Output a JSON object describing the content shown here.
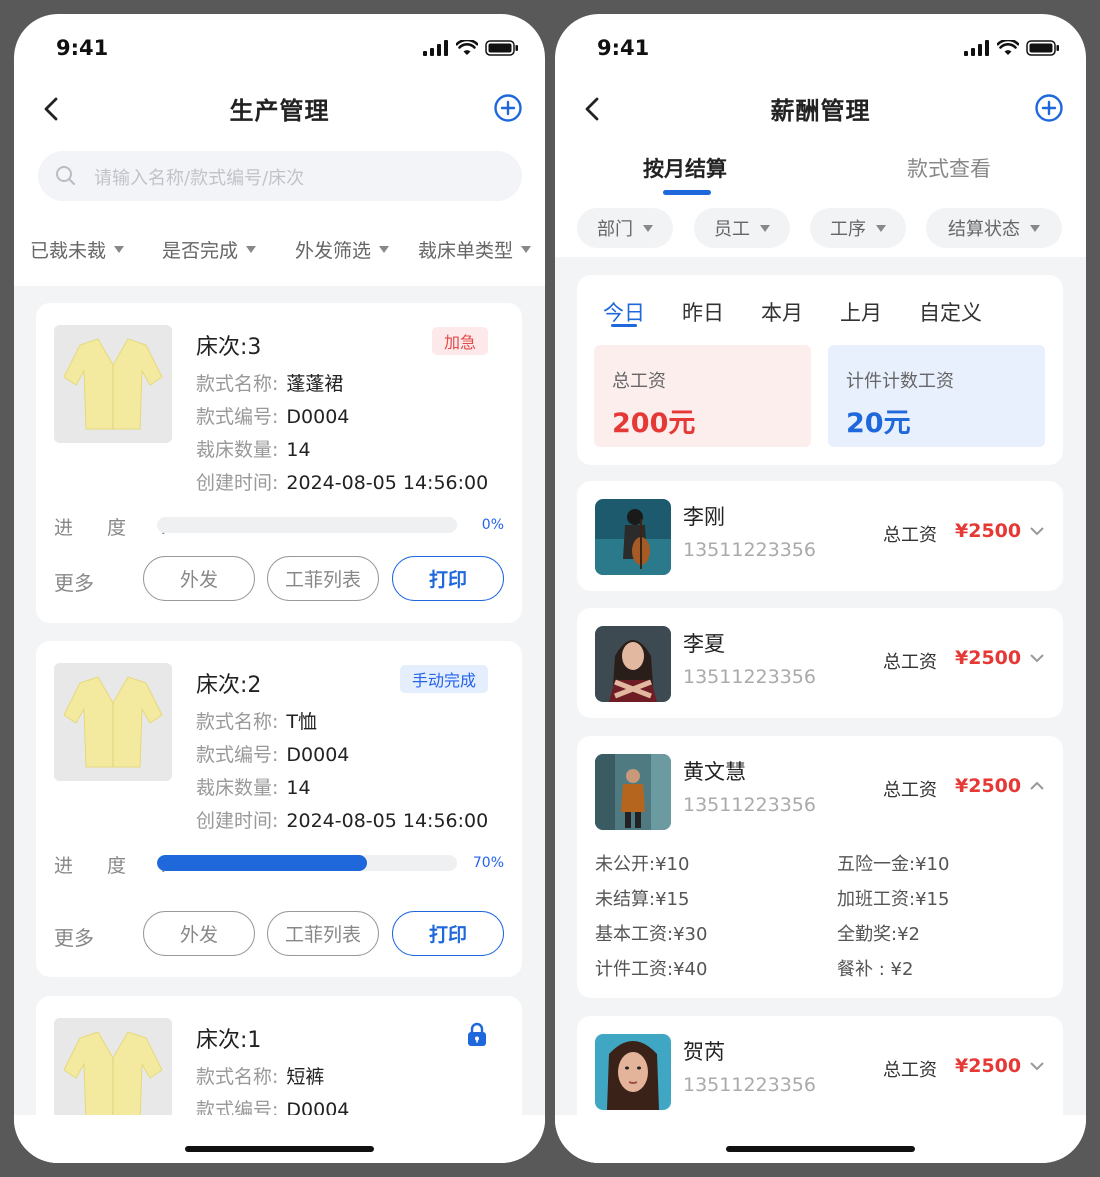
{
  "status_time": "9:41",
  "production": {
    "title": "生产管理",
    "search_placeholder": "请输入名称/款式编号/床次",
    "filters": [
      "已裁未裁",
      "是否完成",
      "外发筛选",
      "裁床单类型"
    ],
    "labels": {
      "style_name": "款式名称:",
      "style_code": "款式编号:",
      "cut_qty": "裁床数量:",
      "created": "创建时间:",
      "progress": "进 度 :",
      "more": "更多",
      "btn_outsource": "外发",
      "btn_ticket_list": "工菲列表",
      "btn_print": "打印"
    },
    "cards": [
      {
        "title": "床次:3",
        "tag": "加急",
        "style_name": "蓬蓬裙",
        "style_code": "D0004",
        "cut_qty": "14",
        "created": "2024-08-05  14:56:00",
        "progress": 0,
        "progress_text": "0%"
      },
      {
        "title": "床次:2",
        "tag": "手动完成",
        "style_name": "T恤",
        "style_code": "D0004",
        "cut_qty": "14",
        "created": "2024-08-05  14:56:00",
        "progress": 0.7,
        "progress_text": "70%"
      },
      {
        "title": "床次:1",
        "tag_icon": "lock-icon",
        "style_name": "短裤",
        "style_code": "D0004"
      }
    ]
  },
  "salary": {
    "title": "薪酬管理",
    "tabs": [
      "按月结算",
      "款式查看"
    ],
    "active_tab": 0,
    "pills": [
      "部门",
      "员工",
      "工序",
      "结算状态"
    ],
    "periods": [
      "今日",
      "昨日",
      "本月",
      "上月",
      "自定义"
    ],
    "active_period": 0,
    "stats": [
      {
        "label": "总工资",
        "value": "200元",
        "color": "#e53935",
        "bg": "#fdeeee"
      },
      {
        "label": "计件计数工资",
        "value": "20元",
        "color": "#1e68dc",
        "bg": "#e8f0fd"
      }
    ],
    "total_label": "总工资",
    "employees": [
      {
        "name": "李刚",
        "phone": "13511223356",
        "total": "¥2500",
        "expanded": false
      },
      {
        "name": "李夏",
        "phone": "13511223356",
        "total": "¥2500",
        "expanded": false
      },
      {
        "name": "黄文慧",
        "phone": "13511223356",
        "total": "¥2500",
        "expanded": true,
        "details": [
          "未公开:¥10",
          "五险一金:¥10",
          "未结算:¥15",
          "加班工资:¥15",
          "基本工资:¥30",
          "全勤奖:¥2",
          "计件工资:¥40",
          "餐补 : ¥2"
        ]
      },
      {
        "name": "贺芮",
        "phone": "13511223356",
        "total": "¥2500",
        "expanded": false
      }
    ]
  }
}
